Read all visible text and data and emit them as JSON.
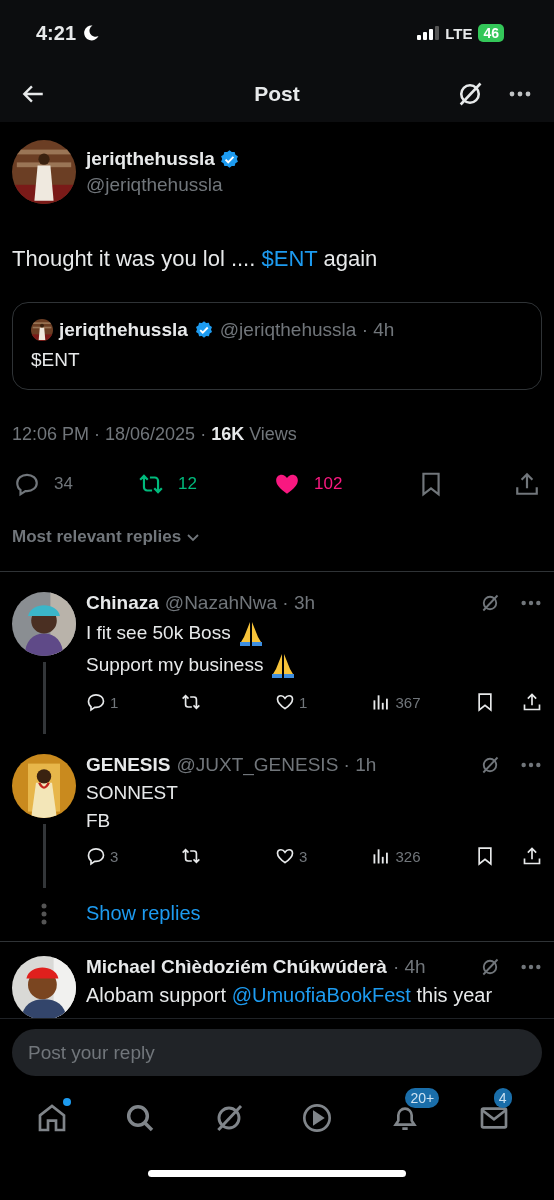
{
  "status_bar": {
    "time": "4:21",
    "network": "LTE",
    "battery": "46"
  },
  "header": {
    "title": "Post"
  },
  "post": {
    "author": {
      "name": "jeriqthehussla",
      "verified": true,
      "handle": "@jeriqthehussla"
    },
    "text": [
      {
        "text": "Thought it was you lol .... "
      },
      {
        "text": "$ENT",
        "link": true
      },
      {
        "text": " again"
      }
    ],
    "quote": {
      "name": "jeriqthehussla",
      "verified": true,
      "meta": "@jeriqthehussla · 4h",
      "text": "$ENT"
    },
    "meta": "12:06 PM · 18/06/2025 · **16K** Views",
    "actions": [
      {
        "kind": "reply",
        "count": "34"
      },
      {
        "kind": "repost",
        "count": "12",
        "active": true
      },
      {
        "kind": "like",
        "count": "102",
        "active": true
      },
      {
        "kind": "bookmark"
      },
      {
        "kind": "share"
      }
    ]
  },
  "sort": {
    "label": "Most relevant replies"
  },
  "replies": [
    {
      "name": "Chinaza",
      "meta": "@NazahNwa · 3h",
      "thread": true,
      "lines": [
        {
          "text": "I fit see 50k Boss",
          "emoji": true
        },
        {
          "text": "Support my business",
          "emoji": true
        }
      ],
      "actions": [
        {
          "kind": "reply",
          "count": "1"
        },
        {
          "kind": "repost"
        },
        {
          "kind": "like",
          "count": "1"
        },
        {
          "kind": "views",
          "count": "367"
        },
        {
          "kind": "bookmark"
        },
        {
          "kind": "share"
        }
      ]
    },
    {
      "name": "GENESIS",
      "meta": "@JUXT_GENESIS · 1h",
      "thread": true,
      "lines": [
        {
          "text": "SONNEST",
          "emoji": false
        },
        {
          "text": "FB",
          "emoji": false
        }
      ],
      "actions": [
        {
          "kind": "reply",
          "count": "3"
        },
        {
          "kind": "repost"
        },
        {
          "kind": "like",
          "count": "3"
        },
        {
          "kind": "views",
          "count": "326"
        },
        {
          "kind": "bookmark"
        },
        {
          "kind": "share"
        }
      ]
    }
  ],
  "show_replies": "Show replies",
  "last_reply": {
    "name": "Michael Chìèdoziém Chúkwúderà",
    "meta": "· 4h",
    "text": [
      {
        "text": "Alobam support "
      },
      {
        "text": "@UmuofiaBookFest",
        "link": true
      },
      {
        "text": " this year"
      }
    ]
  },
  "reply_box": {
    "placeholder": "Post your reply"
  },
  "nav": [
    {
      "kind": "home",
      "dot": true
    },
    {
      "kind": "search"
    },
    {
      "kind": "grok"
    },
    {
      "kind": "video"
    },
    {
      "kind": "bell",
      "badge": "20+"
    },
    {
      "kind": "mail",
      "badge": "4"
    }
  ]
}
